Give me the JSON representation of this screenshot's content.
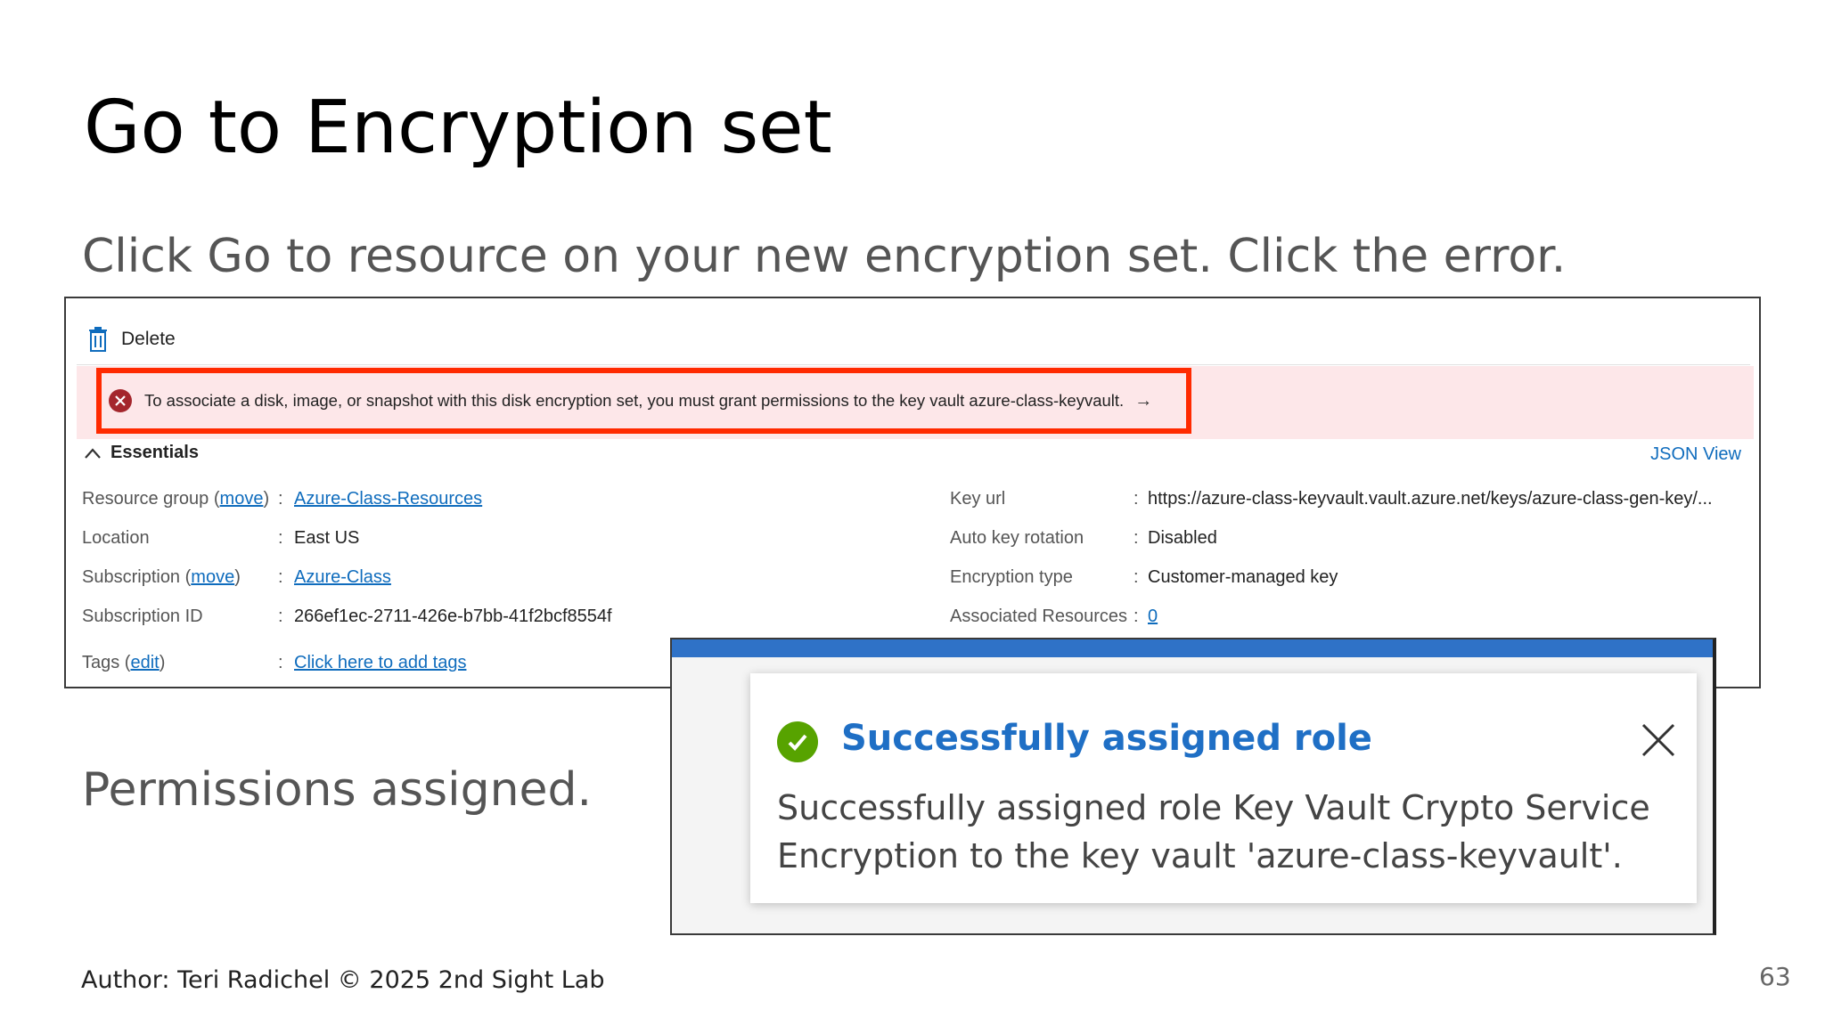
{
  "slide": {
    "title": "Go to Encryption set",
    "instruction": "Click Go to resource on your new encryption set. Click the error.",
    "permissions_note": "Permissions assigned.",
    "footer": "Author: Teri Radichel © 2025 2nd Sight Lab",
    "page_number": "63"
  },
  "azure": {
    "toolbar": {
      "delete_label": "Delete",
      "icon": "trash-icon"
    },
    "error_banner": {
      "icon": "error-circle-icon",
      "text": "To associate a disk, image, or snapshot with this disk encryption set, you must grant permissions to the key vault azure-class-keyvault.",
      "arrow": "→"
    },
    "essentials": {
      "label": "Essentials",
      "json_view": "JSON View",
      "left": {
        "resource_group": {
          "label": "Resource group",
          "move": "move",
          "value": "Azure-Class-Resources"
        },
        "location": {
          "label": "Location",
          "value": "East US"
        },
        "subscription": {
          "label": "Subscription",
          "move": "move",
          "value": "Azure-Class"
        },
        "subscription_id": {
          "label": "Subscription ID",
          "value": "266ef1ec-2711-426e-b7bb-41f2bcf8554f"
        },
        "tags": {
          "label": "Tags",
          "edit": "edit",
          "value": "Click here to add tags"
        }
      },
      "right": {
        "key_url": {
          "label": "Key url",
          "value": "https://azure-class-keyvault.vault.azure.net/keys/azure-class-gen-key/..."
        },
        "auto_key_rotation": {
          "label": "Auto key rotation",
          "value": "Disabled"
        },
        "encryption_type": {
          "label": "Encryption type",
          "value": "Customer-managed key"
        },
        "associated_resources": {
          "label": "Associated Resources",
          "value": "0"
        }
      }
    }
  },
  "notification": {
    "title": "Successfully assigned role",
    "body": "Successfully assigned role Key Vault Crypto Service Encryption to the key vault 'azure-class-keyvault'.",
    "colors": {
      "title": "#1f6fc5",
      "success": "#57a300",
      "bar": "#2f72c7"
    }
  },
  "colors": {
    "error_border": "#ff2a00",
    "error_bg": "#fde7e9",
    "link": "#0f6cbd"
  }
}
